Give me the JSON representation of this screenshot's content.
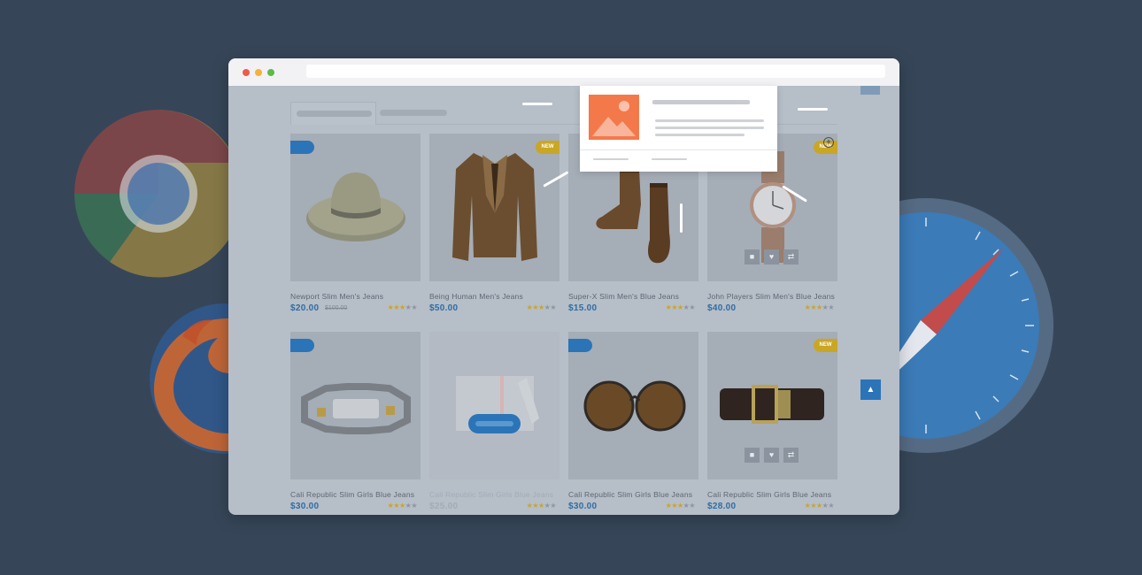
{
  "background_icons": [
    "chrome-logo-icon",
    "firefox-logo-icon",
    "safari-compass-icon"
  ],
  "window": {
    "controls": [
      "close-dot",
      "minimize-dot",
      "maximize-dot"
    ],
    "colors": {
      "accent": "#2b74b8",
      "price": "#2f6da3",
      "new_badge": "#c9a624",
      "popup_thumb": "#f4794a"
    }
  },
  "products": [
    {
      "name": "Newport Slim Men's Jeans",
      "price": "$20.00",
      "old_price": "$100.00",
      "rating": 3,
      "badge": "sale",
      "new_label": ""
    },
    {
      "name": "Being Human Men's Jeans",
      "price": "$50.00",
      "old_price": "",
      "rating": 3,
      "badge": "new",
      "new_label": "NEW"
    },
    {
      "name": "Super-X Slim Men's Blue Jeans",
      "price": "$15.00",
      "old_price": "",
      "rating": 3,
      "badge": "",
      "new_label": ""
    },
    {
      "name": "John Players Slim Men's Blue Jeans",
      "price": "$40.00",
      "old_price": "",
      "rating": 3,
      "badge": "new",
      "new_label": "NEW"
    },
    {
      "name": "Cali Republic Slim Girls Blue Jeans",
      "price": "$30.00",
      "old_price": "",
      "rating": 3,
      "badge": "sale",
      "new_label": ""
    },
    {
      "name": "Cali Republic Slim Girls Blue Jeans",
      "price": "$25.00",
      "old_price": "",
      "rating": 3,
      "badge": "",
      "new_label": ""
    },
    {
      "name": "Cali Republic Slim Girls Blue Jeans",
      "price": "$30.00",
      "old_price": "",
      "rating": 3,
      "badge": "sale",
      "new_label": ""
    },
    {
      "name": "Cali Republic Slim Girls Blue Jeans",
      "price": "$28.00",
      "old_price": "",
      "rating": 3,
      "badge": "new",
      "new_label": "NEW"
    }
  ],
  "popup": {
    "thumbnail_icon": "image-placeholder-icon"
  },
  "icons": {
    "cart": "lock-icon",
    "wishlist": "heart-icon",
    "compare": "shuffle-icon",
    "scroll_top": "chevron-up-icon",
    "compare_top": "plus-circle-icon"
  }
}
